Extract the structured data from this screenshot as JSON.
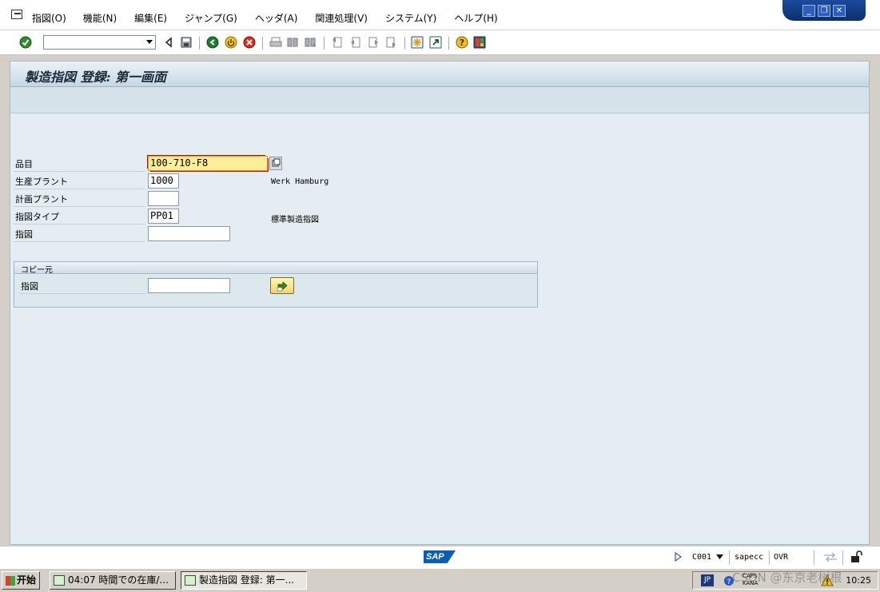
{
  "menubar": {
    "items": [
      "指図(O)",
      "機能(N)",
      "編集(E)",
      "ジャンプ(G)",
      "ヘッダ(A)",
      "関連処理(V)",
      "システム(Y)",
      "ヘルプ(H)"
    ]
  },
  "window_controls": {
    "minimize": "_",
    "restore": "❐",
    "close": "✕"
  },
  "toolbar": {
    "command_field_value": "",
    "icons": [
      "enter-icon",
      "back-icon",
      "save-icon",
      "back-green-icon",
      "exit-icon",
      "cancel-icon",
      "print-icon",
      "find-icon",
      "find-next-icon",
      "first-page-icon",
      "prev-page-icon",
      "next-page-icon",
      "last-page-icon",
      "new-session-icon",
      "shortcut-icon",
      "help-icon",
      "customize-layout-icon"
    ]
  },
  "screen": {
    "title": "製造指図 登録: 第一画面"
  },
  "form": {
    "material": {
      "label": "品目",
      "value": "100-710-F8"
    },
    "production_plant": {
      "label": "生産プラント",
      "value": "1000",
      "description": "Werk Hamburg"
    },
    "planning_plant": {
      "label": "計画プラント",
      "value": ""
    },
    "order_type": {
      "label": "指図タイプ",
      "value": "PP01",
      "description": "標準製造指図"
    },
    "order": {
      "label": "指図",
      "value": ""
    }
  },
  "copy_from": {
    "title": "コピー元",
    "order": {
      "label": "指図",
      "value": ""
    }
  },
  "statusbar": {
    "logo": "SAP",
    "client": "C001",
    "server": "sapecc",
    "mode": "OVR"
  },
  "taskbar": {
    "start_label": "开始",
    "tasks": [
      {
        "label": "04:07 時間での在庫/..."
      },
      {
        "label": "製造指図 登録: 第一..."
      }
    ],
    "tray": {
      "lang": "JP",
      "caps": "CAPS\nKANA",
      "clock": "10:25"
    },
    "watermark": "CSDN @东京老树根"
  }
}
